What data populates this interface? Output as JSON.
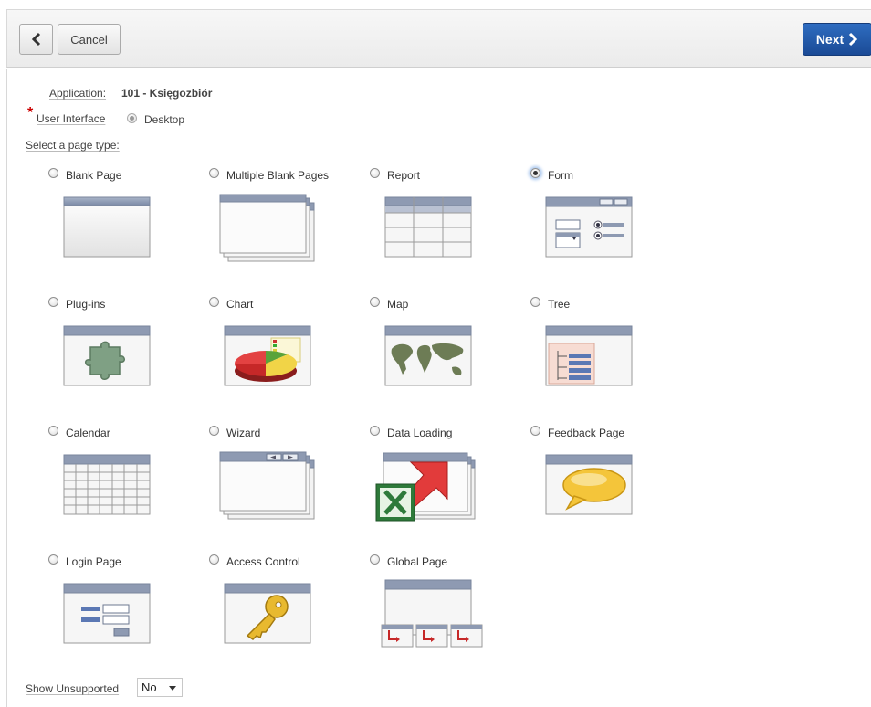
{
  "toolbar": {
    "back_icon": "chevron-left-icon",
    "cancel_label": "Cancel",
    "next_label": "Next",
    "next_icon": "chevron-right-icon",
    "accent": "#1f58a8"
  },
  "form": {
    "application_label": "Application:",
    "application_value": "101 - Księgozbiór",
    "ui_label": "User Interface",
    "ui_required_marker": "*",
    "ui_value": "Desktop",
    "select_prompt": "Select a page type:"
  },
  "page_types": [
    {
      "label": "Blank Page",
      "selected": false
    },
    {
      "label": "Multiple Blank Pages",
      "selected": false
    },
    {
      "label": "Report",
      "selected": false
    },
    {
      "label": "Form",
      "selected": true
    },
    {
      "label": "Plug-ins",
      "selected": false
    },
    {
      "label": "Chart",
      "selected": false
    },
    {
      "label": "Map",
      "selected": false
    },
    {
      "label": "Tree",
      "selected": false
    },
    {
      "label": "Calendar",
      "selected": false
    },
    {
      "label": "Wizard",
      "selected": false
    },
    {
      "label": "Data Loading",
      "selected": false
    },
    {
      "label": "Feedback Page",
      "selected": false
    },
    {
      "label": "Login Page",
      "selected": false
    },
    {
      "label": "Access Control",
      "selected": false
    },
    {
      "label": "Global Page",
      "selected": false
    }
  ],
  "show_unsupported": {
    "label": "Show Unsupported",
    "value": "No"
  }
}
